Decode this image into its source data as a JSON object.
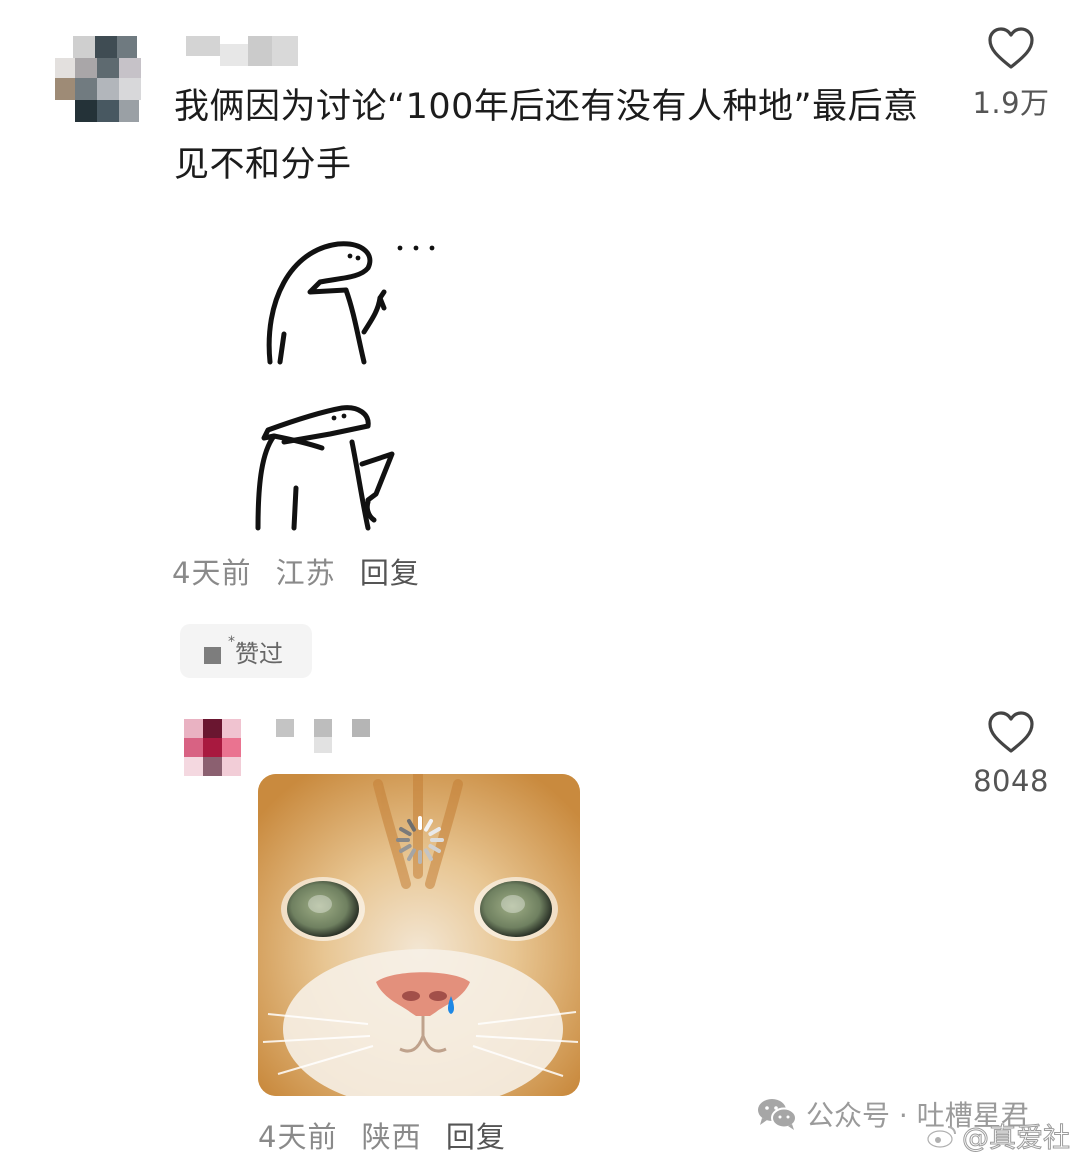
{
  "comment1": {
    "text": "我俩因为讨论“100年后还有没有人种地”最后意见不和分手",
    "time": "4天前",
    "location": "江苏",
    "reply": "回复",
    "likes": "1.9万"
  },
  "liked_chip": {
    "label": "赞过",
    "prefix": "*"
  },
  "comment2": {
    "time": "4天前",
    "location": "陕西",
    "reply": "回复",
    "likes": "8048"
  },
  "watermark": {
    "channel": "公众号 · 吐槽星君",
    "source": "@真爱社"
  },
  "icons": {
    "like": "heart-outline-icon",
    "wechat": "wechat-icon",
    "weibo": "weibo-icon",
    "loading": "spinner-icon"
  },
  "colors": {
    "text": "#1c1c1c",
    "meta": "#8a8a8a",
    "like_count": "#555555"
  }
}
